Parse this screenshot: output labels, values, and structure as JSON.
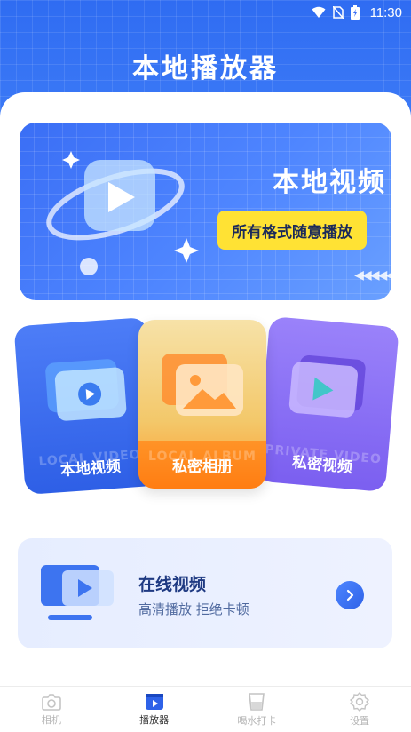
{
  "status_bar": {
    "time": "11:30"
  },
  "header": {
    "title": "本地播放器"
  },
  "banner": {
    "title": "本地视频",
    "pill": "所有格式随意播放"
  },
  "cards": [
    {
      "label": "本地视频",
      "watermark": "LOCAL VIDEO"
    },
    {
      "label": "私密相册",
      "watermark": "LOCAL ALBUM"
    },
    {
      "label": "私密视频",
      "watermark": "PRIVATE VIDEO"
    }
  ],
  "online": {
    "title": "在线视频",
    "subtitle": "高清播放 拒绝卡顿"
  },
  "nav": [
    {
      "label": "相机",
      "icon": "camera-icon"
    },
    {
      "label": "播放器",
      "icon": "player-icon"
    },
    {
      "label": "喝水打卡",
      "icon": "water-cup-icon"
    },
    {
      "label": "设置",
      "icon": "gear-icon"
    }
  ],
  "colors": {
    "primary": "#3a6ef5",
    "pill": "#ffe234",
    "card_blue": "#2e5fe6",
    "card_orange": "#ff7d12",
    "card_purple": "#7b5ff0"
  }
}
